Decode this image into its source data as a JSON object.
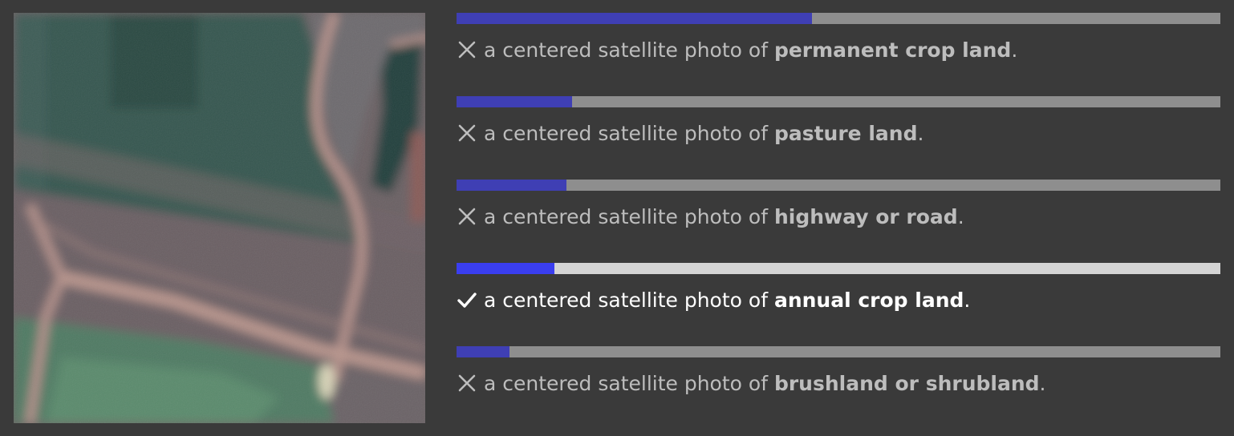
{
  "image": {
    "alt_icon": "satellite-photo",
    "colors": {
      "field_dark": "#2f5048",
      "field_green": "#4e7a66",
      "field_brown": "#6e6064",
      "road": "#b8948c"
    }
  },
  "predictions": [
    {
      "prefix": "a centered satellite photo of ",
      "label": "permanent crop land",
      "suffix": ".",
      "score": 0.465,
      "correct": false,
      "icon": "cross-icon"
    },
    {
      "prefix": "a centered satellite photo of ",
      "label": "pasture land",
      "suffix": ".",
      "score": 0.151,
      "correct": false,
      "icon": "cross-icon"
    },
    {
      "prefix": "a centered satellite photo of ",
      "label": "highway or road",
      "suffix": ".",
      "score": 0.144,
      "correct": false,
      "icon": "cross-icon"
    },
    {
      "prefix": "a centered satellite photo of ",
      "label": "annual crop land",
      "suffix": ".",
      "score": 0.128,
      "correct": true,
      "icon": "check-icon"
    },
    {
      "prefix": "a centered satellite photo of ",
      "label": "brushland or shrubland",
      "suffix": ".",
      "score": 0.069,
      "correct": false,
      "icon": "cross-icon"
    }
  ],
  "colors": {
    "background": "#3a3a3a",
    "bar_fill": "#3f3fb4",
    "bar_fill_correct": "#3a3ef0",
    "bar_track": "#8e8e8e",
    "bar_track_correct": "#d4d4d4",
    "text": "#bdbdbd",
    "text_correct": "#ffffff"
  }
}
